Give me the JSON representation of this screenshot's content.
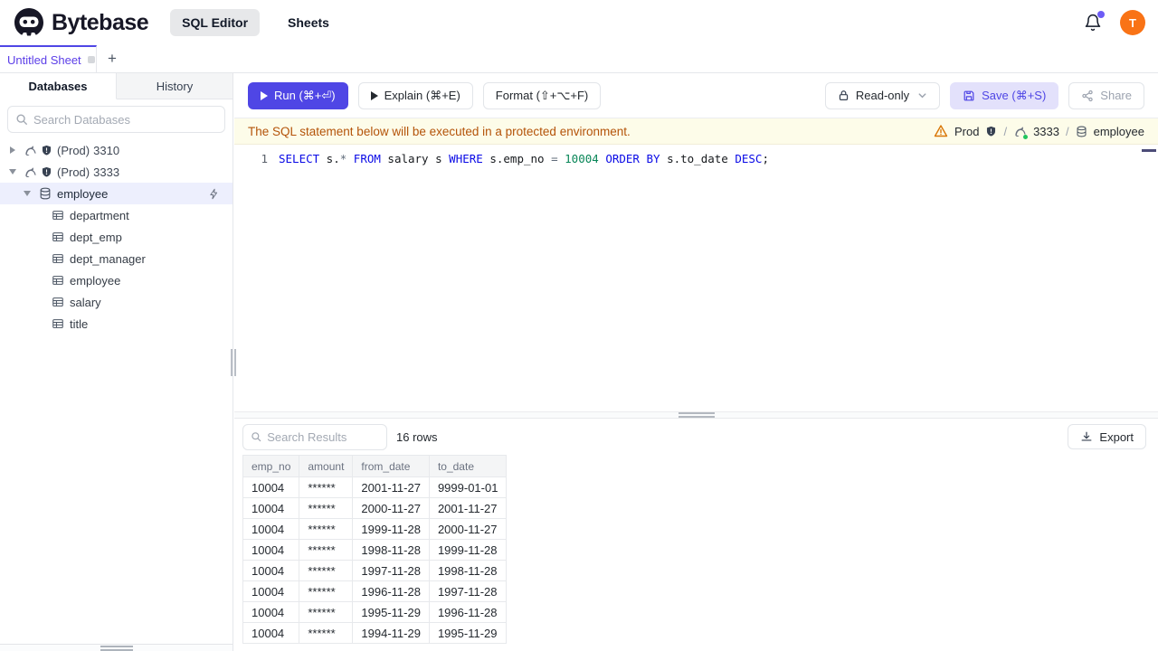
{
  "topbar": {
    "brand": "Bytebase",
    "nav": [
      {
        "label": "SQL Editor"
      },
      {
        "label": "Sheets"
      }
    ],
    "avatar": "T"
  },
  "tabstrip": {
    "sheet": "Untitled Sheet",
    "add": "+"
  },
  "sidebar": {
    "tabs": [
      {
        "label": "Databases"
      },
      {
        "label": "History"
      }
    ],
    "search_placeholder": "Search Databases",
    "instances": [
      {
        "env": "(Prod)",
        "id": "3310",
        "expanded": false
      },
      {
        "env": "(Prod)",
        "id": "3333",
        "expanded": true
      }
    ],
    "database": "employee",
    "tables": [
      "department",
      "dept_emp",
      "dept_manager",
      "employee",
      "salary",
      "title"
    ]
  },
  "toolbar": {
    "run": "Run (⌘+⏎)",
    "explain": "Explain (⌘+E)",
    "format": "Format (⇧+⌥+F)",
    "readonly": "Read-only",
    "save": "Save (⌘+S)",
    "share": "Share"
  },
  "banner": {
    "message": "The SQL statement below will be executed in a protected environment.",
    "env": "Prod",
    "sep": "/",
    "instance": "3333",
    "database": "employee"
  },
  "editor": {
    "line_number": "1",
    "tokens": [
      {
        "text": "SELECT",
        "type": "keyword"
      },
      {
        "text": " s.",
        "type": "plain"
      },
      {
        "text": "*",
        "type": "operator"
      },
      {
        "text": " ",
        "type": "plain"
      },
      {
        "text": "FROM",
        "type": "keyword"
      },
      {
        "text": " salary s ",
        "type": "plain"
      },
      {
        "text": "WHERE",
        "type": "keyword"
      },
      {
        "text": " s.emp_no ",
        "type": "plain"
      },
      {
        "text": "=",
        "type": "operator"
      },
      {
        "text": " ",
        "type": "plain"
      },
      {
        "text": "10004",
        "type": "number"
      },
      {
        "text": " ",
        "type": "plain"
      },
      {
        "text": "ORDER",
        "type": "keyword"
      },
      {
        "text": " ",
        "type": "plain"
      },
      {
        "text": "BY",
        "type": "keyword"
      },
      {
        "text": " s.to_date ",
        "type": "plain"
      },
      {
        "text": "DESC",
        "type": "keyword"
      },
      {
        "text": ";",
        "type": "plain"
      }
    ]
  },
  "results": {
    "search_placeholder": "Search Results",
    "count": "16 rows",
    "export": "Export",
    "columns": [
      "emp_no",
      "amount",
      "from_date",
      "to_date"
    ],
    "rows": [
      [
        "10004",
        "******",
        "2001-11-27",
        "9999-01-01"
      ],
      [
        "10004",
        "******",
        "2000-11-27",
        "2001-11-27"
      ],
      [
        "10004",
        "******",
        "1999-11-28",
        "2000-11-27"
      ],
      [
        "10004",
        "******",
        "1998-11-28",
        "1999-11-28"
      ],
      [
        "10004",
        "******",
        "1997-11-28",
        "1998-11-28"
      ],
      [
        "10004",
        "******",
        "1996-11-28",
        "1997-11-28"
      ],
      [
        "10004",
        "******",
        "1995-11-29",
        "1996-11-28"
      ],
      [
        "10004",
        "******",
        "1994-11-29",
        "1995-11-29"
      ]
    ]
  },
  "colors": {
    "accent": "#4f46e5",
    "avatar": "#f97316",
    "banner_bg": "#fdfce9",
    "banner_text": "#b45309",
    "sql_keyword": "#0a0ae6",
    "sql_number": "#098658",
    "selected_row_bg": "#edeffd",
    "notification_dot": "#6d5cf6",
    "status_dot": "#22c55e"
  }
}
